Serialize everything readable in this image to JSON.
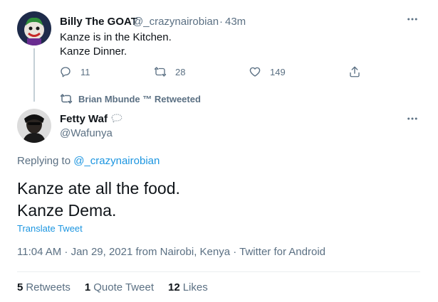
{
  "parent_tweet": {
    "display_name": "Billy The GOAT",
    "handle": "@_crazynairobian",
    "separator": "·",
    "time": "43m",
    "text": "Kanze is in the Kitchen.\nKanze Dinner.",
    "replies": "11",
    "retweets": "28",
    "likes": "149"
  },
  "retweet_banner": {
    "text": "Brian Mbunde ™ Retweeted"
  },
  "main_tweet": {
    "display_name": "Fetty Waf",
    "handle": "@Wafunya",
    "replying_prefix": "Replying to",
    "replying_handle": "@_crazynairobian",
    "text": "Kanze ate all the food.\nKanze Dema.",
    "translate_label": "Translate Tweet",
    "meta": "11:04 AM · Jan 29, 2021 from Nairobi, Kenya · Twitter for Android",
    "stats": {
      "retweets_count": "5",
      "retweets_label": "Retweets",
      "quotes_count": "1",
      "quotes_label": "Quote Tweet",
      "likes_count": "12",
      "likes_label": "Likes"
    }
  },
  "icons": {
    "more": "more-icon",
    "reply": "reply-icon",
    "retweet": "retweet-icon",
    "like": "heart-icon",
    "share": "share-icon",
    "emoji": "speech-balloon-emoji"
  },
  "colors": {
    "link_blue": "#1b95e0",
    "muted_gray": "#5b7083",
    "text_dark": "#0f1419"
  }
}
